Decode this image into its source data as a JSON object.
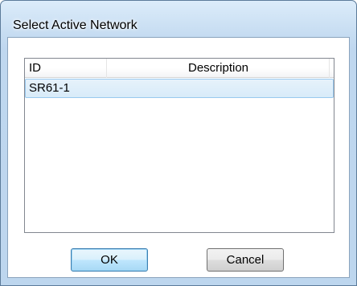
{
  "window": {
    "title": "Select Active Network"
  },
  "list": {
    "columns": [
      {
        "label": "ID"
      },
      {
        "label": "Description"
      }
    ],
    "rows": [
      {
        "id": "SR61-1",
        "description": ""
      }
    ],
    "selected_row_color": "#d8ebf9"
  },
  "buttons": {
    "ok_label": "OK",
    "cancel_label": "Cancel"
  }
}
